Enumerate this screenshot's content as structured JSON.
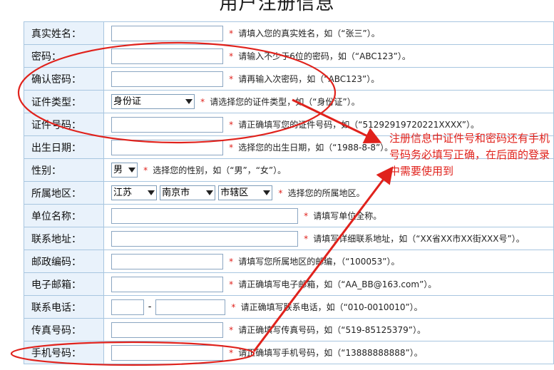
{
  "page": {
    "title": "用户注册信息"
  },
  "form": {
    "required_mark": "*",
    "rows": {
      "real_name": {
        "label": "真实姓名：",
        "value": "",
        "hint": "请填入您的真实姓名，如（“张三”）。"
      },
      "password": {
        "label": "密码：",
        "value": "",
        "hint": "请输入不少于6位的密码，如（“ABC123”）。"
      },
      "confirm_password": {
        "label": "确认密码：",
        "value": "",
        "hint": "请再输入次密码，如（“ABC123”）。"
      },
      "id_type": {
        "label": "证件类型：",
        "selected": "身份证",
        "hint": "请选择您的证件类型，如（“身份证”）。"
      },
      "id_number": {
        "label": "证件号码：",
        "value": "",
        "hint": "请正确填写您的证件号码，如（“51292919720221XXXX”）。"
      },
      "birth_date": {
        "label": "出生日期：",
        "value": "",
        "hint": "选择您的出生日期，如（“1988-8-8”）。"
      },
      "gender": {
        "label": "性别：",
        "selected": "男",
        "hint": "选择您的性别，如（“男”，“女”）。"
      },
      "region": {
        "label": "所属地区：",
        "province": "江苏",
        "city": "南京市",
        "district": "市辖区",
        "hint": "选择您的所属地区。"
      },
      "company": {
        "label": "单位名称：",
        "value": "",
        "hint": "请填写单位全称。"
      },
      "address": {
        "label": "联系地址：",
        "value": "",
        "hint": "请填写详细联系地址，如（“XX省XX市XX街XXX号”）。"
      },
      "postcode": {
        "label": "邮政编码：",
        "value": "",
        "hint": "请填写您所属地区的邮编，（“100053”）。"
      },
      "email": {
        "label": "电子邮箱：",
        "value": "",
        "hint": "请正确填写电子邮箱，如（“AA_BB@163.com”）。"
      },
      "phone": {
        "label": "联系电话：",
        "area": "",
        "number": "",
        "separator": "-",
        "hint": "请正确填写联系电话，如（“010-0010010”）。"
      },
      "fax": {
        "label": "传真号码：",
        "value": "",
        "hint": "请正确填写传真号码，如（“519-85125379”）。"
      },
      "mobile": {
        "label": "手机号码：",
        "value": "",
        "hint": "请正确填写手机号码，如（“13888888888”）。"
      }
    }
  },
  "annotation": {
    "text": "注册信息中证件号和密码还有手机号码务必填写正确，在后面的登录中需要使用到",
    "color": "#e0221c"
  },
  "colors": {
    "label_bg": "#e9f2fb",
    "border": "#a8c6e0",
    "required": "#e0221c"
  }
}
